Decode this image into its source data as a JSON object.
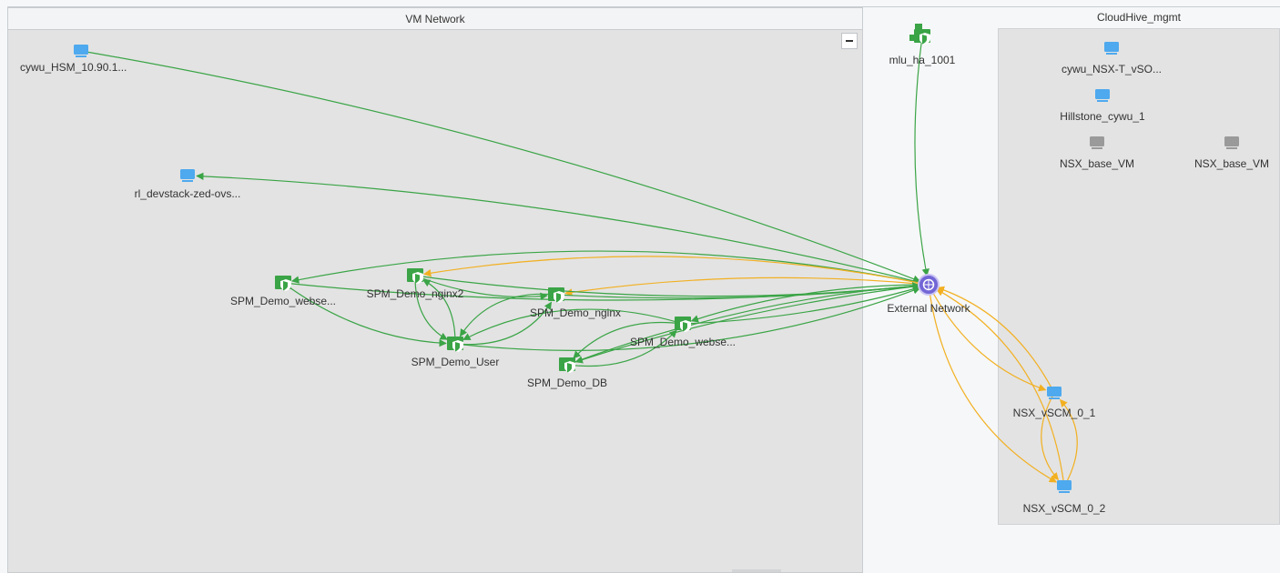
{
  "groups": {
    "vm_network": "VM Network",
    "cloudhive": "CloudHive_mgmt"
  },
  "colors": {
    "link_green": "#3aa446",
    "link_orange": "#f2b021",
    "vm_blue": "#4ea9ee",
    "vm_gray": "#9a9a9a",
    "node_green": "#3aa446",
    "external_purple": "#7266d6"
  },
  "nodes": [
    {
      "id": "cywu_hsm",
      "label": "cywu_HSM_10.90.1...",
      "icon": "monitor-icon",
      "color": "blue"
    },
    {
      "id": "rl_devstack",
      "label": "rl_devstack-zed-ovs...",
      "icon": "monitor-icon",
      "color": "blue"
    },
    {
      "id": "spm_webse1",
      "label": "SPM_Demo_webse...",
      "icon": "security-group-icon",
      "color": "green"
    },
    {
      "id": "spm_nginx2",
      "label": "SPM_Demo_nginx2",
      "icon": "security-group-icon",
      "color": "green"
    },
    {
      "id": "spm_nginx",
      "label": "SPM_Demo_nginx",
      "icon": "security-group-icon",
      "color": "green"
    },
    {
      "id": "spm_user",
      "label": "SPM_Demo_User",
      "icon": "security-group-icon",
      "color": "green"
    },
    {
      "id": "spm_webse2",
      "label": "SPM_Demo_webse...",
      "icon": "security-group-icon",
      "color": "green"
    },
    {
      "id": "spm_db",
      "label": "SPM_Demo_DB",
      "icon": "security-group-icon",
      "color": "green"
    },
    {
      "id": "mlu_ha",
      "label": "mlu_ha_1001",
      "icon": "security-group-multi-icon",
      "color": "green"
    },
    {
      "id": "external",
      "label": "External Network",
      "icon": "external-network-icon",
      "color": "purple"
    },
    {
      "id": "cywu_nsx",
      "label": "cywu_NSX-T_vSO...",
      "icon": "monitor-icon",
      "color": "blue"
    },
    {
      "id": "hillstone",
      "label": "Hillstone_cywu_1",
      "icon": "monitor-icon",
      "color": "blue"
    },
    {
      "id": "nsx_base1",
      "label": "NSX_base_VM",
      "icon": "monitor-icon",
      "color": "gray"
    },
    {
      "id": "nsx_base2",
      "label": "NSX_base_VM",
      "icon": "monitor-icon",
      "color": "gray"
    },
    {
      "id": "nsx_vscm1",
      "label": "NSX_vSCM_0_1",
      "icon": "monitor-icon",
      "color": "blue"
    },
    {
      "id": "nsx_vscm2",
      "label": "NSX_vSCM_0_2",
      "icon": "monitor-icon",
      "color": "blue"
    }
  ],
  "edges": [
    {
      "from": "cywu_hsm",
      "to": "external",
      "color": "green"
    },
    {
      "from": "external",
      "to": "rl_devstack",
      "color": "green"
    },
    {
      "from": "mlu_ha",
      "to": "external",
      "color": "green"
    },
    {
      "from": "external",
      "to": "spm_webse1",
      "color": "green"
    },
    {
      "from": "external",
      "to": "spm_nginx2",
      "color": "orange"
    },
    {
      "from": "external",
      "to": "spm_nginx",
      "color": "orange"
    },
    {
      "from": "spm_webse1",
      "to": "external",
      "color": "green"
    },
    {
      "from": "spm_nginx2",
      "to": "external",
      "color": "green"
    },
    {
      "from": "spm_nginx",
      "to": "external",
      "color": "green"
    },
    {
      "from": "spm_user",
      "to": "external",
      "color": "green"
    },
    {
      "from": "spm_webse2",
      "to": "external",
      "color": "green"
    },
    {
      "from": "spm_db",
      "to": "external",
      "color": "green"
    },
    {
      "from": "external",
      "to": "spm_webse2",
      "color": "green"
    },
    {
      "from": "external",
      "to": "spm_db",
      "color": "green"
    },
    {
      "from": "spm_webse1",
      "to": "spm_user",
      "color": "green"
    },
    {
      "from": "spm_nginx2",
      "to": "spm_user",
      "color": "green"
    },
    {
      "from": "spm_user",
      "to": "spm_nginx2",
      "color": "green"
    },
    {
      "from": "spm_nginx",
      "to": "spm_user",
      "color": "green"
    },
    {
      "from": "spm_user",
      "to": "spm_nginx",
      "color": "green"
    },
    {
      "from": "spm_nginx2",
      "to": "spm_nginx",
      "color": "green"
    },
    {
      "from": "spm_webse2",
      "to": "spm_user",
      "color": "green"
    },
    {
      "from": "spm_webse2",
      "to": "spm_db",
      "color": "green"
    },
    {
      "from": "spm_db",
      "to": "spm_webse2",
      "color": "green"
    },
    {
      "from": "external",
      "to": "nsx_vscm1",
      "color": "orange"
    },
    {
      "from": "nsx_vscm1",
      "to": "external",
      "color": "orange"
    },
    {
      "from": "external",
      "to": "nsx_vscm2",
      "color": "orange"
    },
    {
      "from": "nsx_vscm2",
      "to": "external",
      "color": "orange"
    },
    {
      "from": "nsx_vscm1",
      "to": "nsx_vscm2",
      "color": "orange"
    },
    {
      "from": "nsx_vscm2",
      "to": "nsx_vscm1",
      "color": "orange"
    }
  ]
}
